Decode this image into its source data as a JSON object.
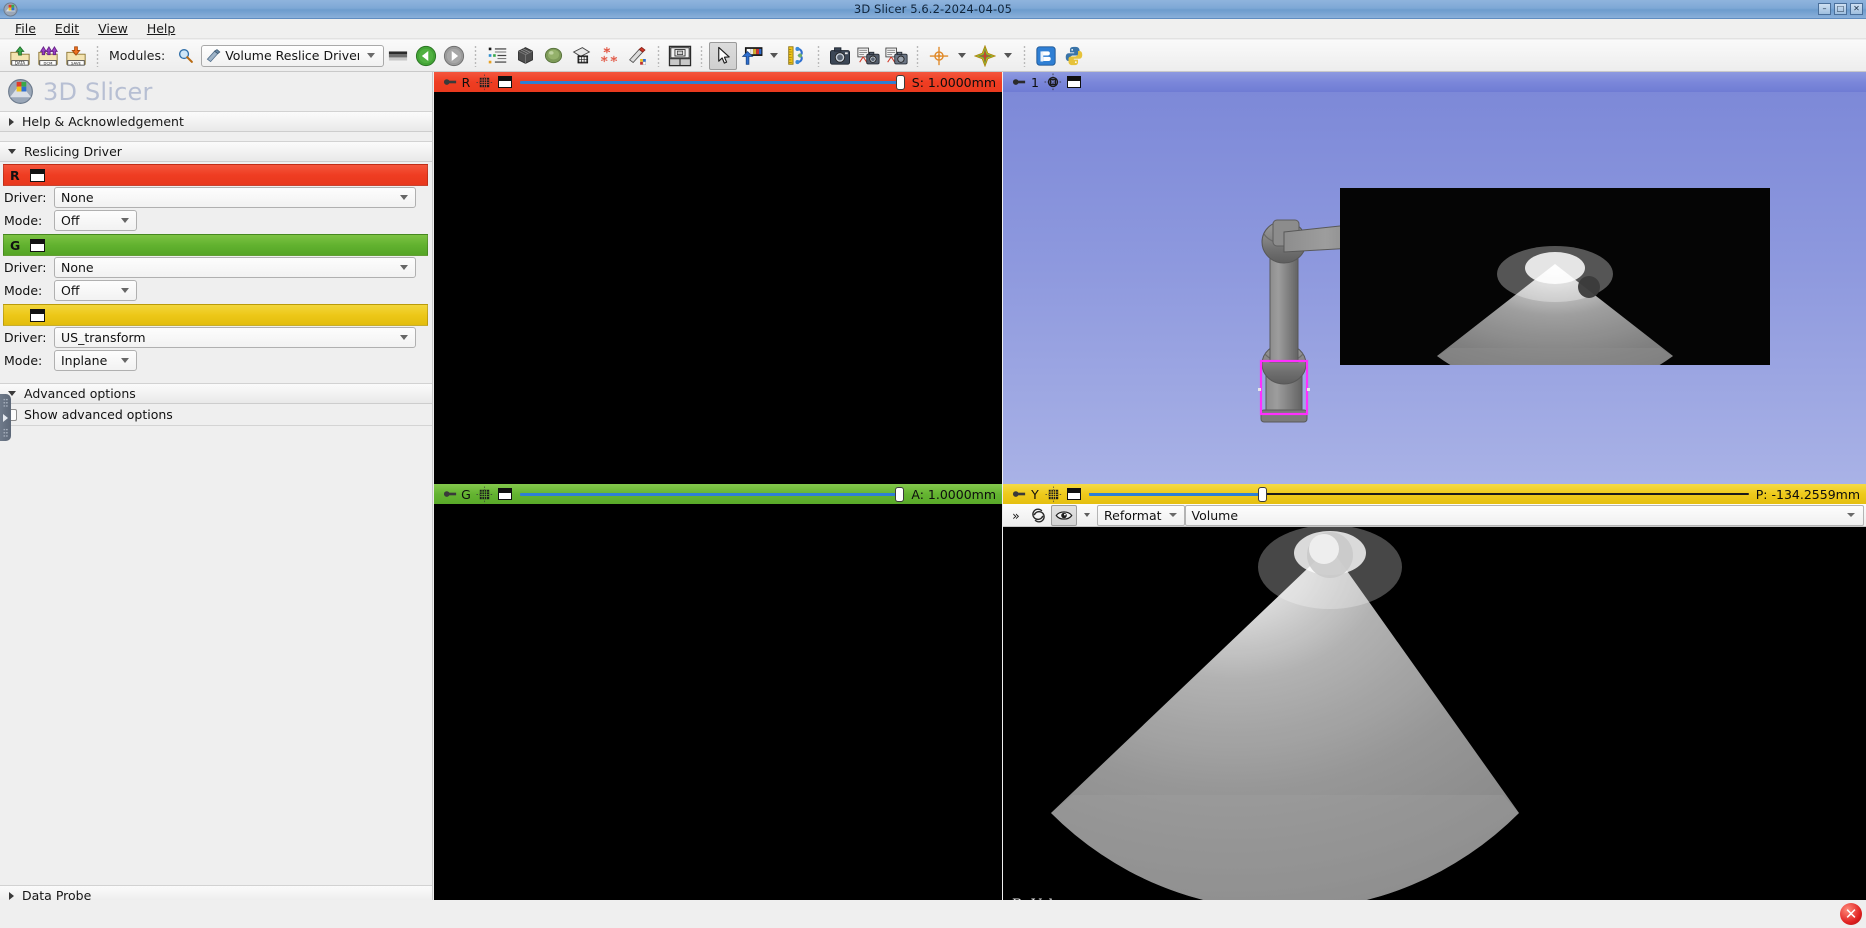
{
  "window": {
    "title": "3D Slicer 5.6.2-2024-04-05",
    "minimize_label": "–",
    "maximize_label": "□",
    "close_label": "✕"
  },
  "menu": [
    {
      "label": "File"
    },
    {
      "label": "Edit"
    },
    {
      "label": "View"
    },
    {
      "label": "Help"
    }
  ],
  "toolbar": {
    "modules_label": "Modules:",
    "module_selected": "Volume Reslice Driver",
    "icons": [
      "load-data-icon",
      "load-dicom-icon",
      "save-data-icon",
      "module-favorites-icon",
      "previous-module-icon",
      "next-module-icon",
      "subject-hierarchy-icon",
      "volumes-icon",
      "models-icon",
      "segmentations-icon",
      "markups-icon",
      "annotations-icon",
      "layout-icon",
      "mouse-mode-pointer-icon",
      "window-level-icon",
      "crosshair-icon",
      "screenshot-icon",
      "scene-views-icon",
      "scene-view-capture-icon",
      "center-view-icon",
      "color-icon",
      "extension-manager-icon",
      "python-console-icon"
    ]
  },
  "left_panel": {
    "brand": "3D Slicer",
    "sections": [
      {
        "id": "help",
        "label": "Help & Acknowledgement",
        "expanded": false
      },
      {
        "id": "reslicing",
        "label": "Reslicing Driver",
        "expanded": true
      },
      {
        "id": "advanced",
        "label": "Advanced options",
        "expanded": true
      },
      {
        "id": "dataprobe",
        "label": "Data Probe",
        "expanded": false
      }
    ],
    "driver_rows": [
      {
        "letter": "R",
        "color": "#ef3d22",
        "driver_label": "Driver:",
        "driver_value": "None",
        "mode_label": "Mode:",
        "mode_value": "Off"
      },
      {
        "letter": "G",
        "color": "#62b22f",
        "driver_label": "Driver:",
        "driver_value": "None",
        "mode_label": "Mode:",
        "mode_value": "Off"
      },
      {
        "letter": "",
        "color": "#edc818",
        "driver_label": "Driver:",
        "driver_value": "US_transform",
        "mode_label": "Mode:",
        "mode_value": "Inplane"
      }
    ],
    "advanced": {
      "checkbox_label": "Show advanced options",
      "checked": false
    }
  },
  "views": {
    "red": {
      "letter": "R",
      "slider_value": "S: 1.0000mm",
      "slider_percent": 100,
      "pin_icon": "pin-icon",
      "visibility_icon": "slice-visibility-icon",
      "layout_icon": "view-layout-icon"
    },
    "green": {
      "letter": "G",
      "slider_value": "A: 1.0000mm",
      "slider_percent": 100,
      "pin_icon": "pin-icon",
      "visibility_icon": "slice-visibility-icon",
      "layout_icon": "view-layout-icon"
    },
    "yellow": {
      "letter": "Y",
      "slider_value": "P: -134.2559mm",
      "slider_percent": 26,
      "pin_icon": "pin-icon",
      "visibility_icon": "slice-visibility-icon",
      "layout_icon": "view-layout-icon"
    },
    "threed": {
      "letter": "1",
      "pin_icon": "pin-icon",
      "center-icon": "center-3d-view-icon",
      "layout_icon": "view-layout-icon"
    },
    "volume_rendering_bar": {
      "more_label": "»",
      "spin_icon": "spin-view-icon",
      "eye_icon": "visibility-eye-icon",
      "reformat_label": "Reformat",
      "volume_label": "Volume"
    },
    "bottom_right_label": "B: Volume"
  },
  "colors": {
    "red": "#ef3d22",
    "green": "#62b22f",
    "yellow": "#edc818",
    "blue_3d": "#7b87da",
    "slider_blue": "#2f7fd4",
    "roi_magenta": "#ff00ff"
  }
}
